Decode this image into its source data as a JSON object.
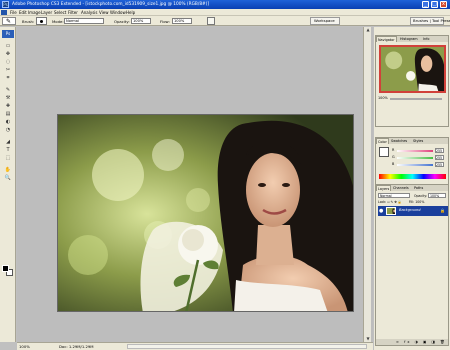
{
  "title": "Adobe Photoshop CS3 Extended - [istockphoto.com_id531909_size1.jpg @ 100% (RGB/8#)]",
  "window": {
    "minimize": "_",
    "maximize": "□",
    "close": "x"
  },
  "menu": [
    "File",
    "Edit",
    "Image",
    "Layer",
    "Select",
    "Filter",
    "Analysis",
    "View",
    "Window",
    "Help"
  ],
  "options": {
    "brush_label": "Brush:",
    "mode_label": "Mode:",
    "mode_value": "Normal",
    "opacity_label": "Opacity:",
    "opacity_value": "100%",
    "flow_label": "Flow:",
    "flow_value": "100%",
    "workspace_label": "Workspace",
    "brushes_tab": "Brushes | Tool Preset"
  },
  "toolbox": {
    "badge": "Ps",
    "tools": [
      "▭",
      "✥",
      "◌",
      "✂",
      "⌗",
      "✎",
      "⚒",
      "✚",
      "▤",
      "◐",
      "◔",
      "◢",
      "T",
      "⬚",
      "✋",
      "🔍"
    ]
  },
  "status": {
    "zoom": "100%",
    "doc": "Doc: 1.29M/1.29M"
  },
  "navigator": {
    "tabs": [
      "Navigator",
      "Histogram",
      "Info"
    ],
    "zoom": "100%"
  },
  "color": {
    "tabs": [
      "Color",
      "Swatches",
      "Styles"
    ],
    "rows": [
      {
        "label": "R",
        "value": "255",
        "color": "#e0407a"
      },
      {
        "label": "G",
        "value": "255",
        "color": "#44bf44"
      },
      {
        "label": "B",
        "value": "255",
        "color": "#4473d0"
      }
    ]
  },
  "layers": {
    "tabs": [
      "Layers",
      "Channels",
      "Paths"
    ],
    "mode": "Normal",
    "opacity_label": "Opacity:",
    "opacity": "100%",
    "lock_label": "Lock:",
    "fill_label": "Fill:",
    "fill": "100%",
    "layer_name": "Background",
    "footer_icons": "∞ fx ◑ ▣ ◨ 🗑"
  }
}
